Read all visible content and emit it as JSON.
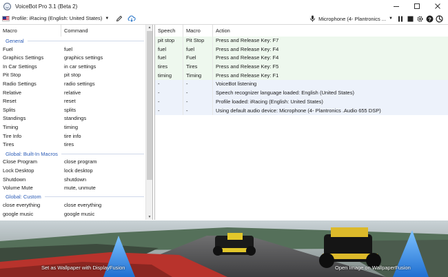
{
  "window": {
    "title": "VoiceBot Pro 3.1 (Beta 2)",
    "controls": [
      "minimize",
      "maximize",
      "close"
    ]
  },
  "toolbar": {
    "profile_label": "Profile: iRacing (English: United States)",
    "microphone_label": "Microphone (4- Plantronics ...",
    "icons": [
      "edit-icon",
      "cloud-download-icon",
      "pause-icon",
      "stop-icon",
      "gear-icon",
      "help-icon",
      "settings-sliders-icon"
    ]
  },
  "macro_list": {
    "headers": {
      "macro": "Macro",
      "command": "Command"
    },
    "groups": [
      {
        "name": "General",
        "items": [
          {
            "macro": "Fuel",
            "command": "fuel"
          },
          {
            "macro": "Graphics Settings",
            "command": "graphics settings"
          },
          {
            "macro": "In Car Settings",
            "command": "in car settings"
          },
          {
            "macro": "Pit Stop",
            "command": "pit stop"
          },
          {
            "macro": "Radio Settings",
            "command": "radio settings"
          },
          {
            "macro": "Relative",
            "command": "relative"
          },
          {
            "macro": "Reset",
            "command": "reset"
          },
          {
            "macro": "Splits",
            "command": "splits"
          },
          {
            "macro": "Standings",
            "command": "standings"
          },
          {
            "macro": "Timing",
            "command": "timing"
          },
          {
            "macro": "Tire Info",
            "command": "tire info"
          },
          {
            "macro": "Tires",
            "command": "tires"
          }
        ]
      },
      {
        "name": "Global: Built-In Macros",
        "items": [
          {
            "macro": "Close Program",
            "command": "close program"
          },
          {
            "macro": "Lock Desktop",
            "command": "lock desktop"
          },
          {
            "macro": "Shutdown",
            "command": "shutdown"
          },
          {
            "macro": "Volume Mute",
            "command": "mute, unmute"
          }
        ]
      },
      {
        "name": "Global: Custom",
        "items": [
          {
            "macro": "close everything",
            "command": "close everything"
          },
          {
            "macro": "google music",
            "command": "google music"
          }
        ]
      }
    ]
  },
  "log": {
    "headers": {
      "speech": "Speech",
      "macro": "Macro",
      "action": "Action"
    },
    "rows": [
      {
        "speech": "pit stop",
        "macro": "Pit Stop",
        "action": "Press and Release Key: F7",
        "kind": "cmd"
      },
      {
        "speech": "fuel",
        "macro": "fuel",
        "action": "Press and Release Key: F4",
        "kind": "cmd"
      },
      {
        "speech": "fuel",
        "macro": "Fuel",
        "action": "Press and Release Key: F4",
        "kind": "cmd"
      },
      {
        "speech": "tires",
        "macro": "Tires",
        "action": "Press and Release Key: F5",
        "kind": "cmd"
      },
      {
        "speech": "timing",
        "macro": "Timing",
        "action": "Press and Release Key: F1",
        "kind": "cmd"
      },
      {
        "speech": "-",
        "macro": "-",
        "action": "VoiceBot listening",
        "kind": "info"
      },
      {
        "speech": "-",
        "macro": "-",
        "action": "Speech recognizer language loaded: English (United States)",
        "kind": "info"
      },
      {
        "speech": "-",
        "macro": "-",
        "action": "Profile loaded: iRacing (English: United States)",
        "kind": "info"
      },
      {
        "speech": "-",
        "macro": "-",
        "action": "Using default audio device: Microphone (4- Plantronics .Audio 655 DSP)",
        "kind": "info"
      }
    ]
  },
  "banner": {
    "left_link": "Set as Wallpaper with DisplayFusion",
    "right_link": "Open Image on WallpaperFusion"
  },
  "colors": {
    "group_header": "#2a5bb7",
    "command_row": "#eef8ee",
    "info_row": "#edf2fb"
  }
}
